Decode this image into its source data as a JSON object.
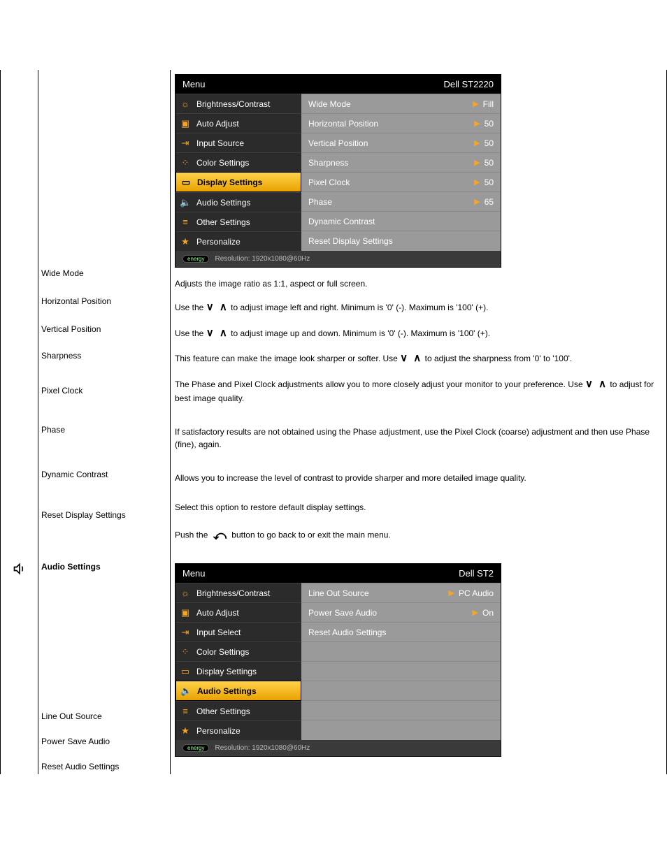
{
  "osd1": {
    "header_left": "Menu",
    "header_right": "Dell ST2220",
    "menu": {
      "brightness": "Brightness/Contrast",
      "auto": "Auto Adjust",
      "input": "Input Source",
      "color": "Color Settings",
      "display": "Display Settings",
      "audio": "Audio Settings",
      "other": "Other Settings",
      "personalize": "Personalize"
    },
    "right": {
      "wide_mode_l": "Wide Mode",
      "wide_mode_v": "Fill",
      "hpos_l": "Horizontal Position",
      "hpos_v": "50",
      "vpos_l": "Vertical Position",
      "vpos_v": "50",
      "sharp_l": "Sharpness",
      "sharp_v": "50",
      "pixel_l": "Pixel Clock",
      "pixel_v": "50",
      "phase_l": "Phase",
      "phase_v": "65",
      "dyncon_l": "Dynamic Contrast",
      "reset_l": "Reset Display Settings"
    },
    "footer": "Resolution:  1920x1080@60Hz"
  },
  "labels": {
    "wide": "Wide Mode",
    "hpos": "Horizontal Position",
    "vpos": "Vertical Position",
    "sharp": "Sharpness",
    "pixel": "Pixel Clock",
    "phase": "Phase",
    "dyn": "Dynamic Contrast",
    "reset": "Reset Display Settings",
    "audio": "Audio Settings",
    "line": "Line Out Source",
    "psave": "Power Save Audio",
    "raudio": "Reset Audio Settings"
  },
  "desc": {
    "wide": "Adjusts the image ratio as 1:1, aspect or full screen.",
    "hpos_1": "Use the ",
    "hpos_2": " to adjust image left and right. Minimum is '0' (-). Maximum is '100' (+).",
    "vpos_1": "Use the ",
    "vpos_2": " to adjust image up and down. Minimum is '0' (-). Maximum is '100' (+).",
    "sharp_1": "This feature can make the image look sharper or softer. Use ",
    "sharp_2": " to adjust the sharpness from '0' to '100'.",
    "pixel_1": "The Phase and Pixel Clock adjustments allow you to more closely adjust your monitor to your preference. Use ",
    "pixel_2": " to adjust for best image quality.",
    "phase": "If satisfactory results are not obtained using the Phase adjustment, use the Pixel Clock (coarse) adjustment and then use Phase (fine), again.",
    "dyn": "Allows you to increase the level of contrast to provide sharper and more detailed image quality.",
    "reset_1": "Select this option to restore default display settings.",
    "reset_2": "Push the ",
    "reset_3": " button to go back to or exit the main menu."
  },
  "osd2": {
    "header_left": "Menu",
    "header_right": "Dell ST2",
    "menu": {
      "brightness": "Brightness/Contrast",
      "auto": "Auto Adjust",
      "input": "Input Select",
      "color": "Color Settings",
      "display": "Display Settings",
      "audio": "Audio Settings",
      "other": "Other Settings",
      "personalize": "Personalize"
    },
    "right": {
      "line_l": "Line Out Source",
      "line_v": "PC Audio",
      "psave_l": "Power Save Audio",
      "psave_v": "On",
      "reset_l": "Reset Audio Settings"
    },
    "footer": "Resolution:  1920x1080@60Hz"
  }
}
